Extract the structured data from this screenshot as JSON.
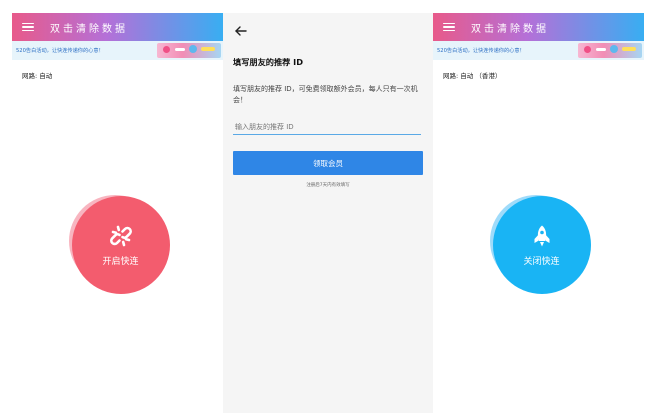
{
  "left": {
    "app_title": "双击清除数据",
    "banner_text": "520告白活动，让快连传递你的心意！",
    "mode_label": "网路: 自动",
    "button_label": "开启快连",
    "accent": "#f35c6e"
  },
  "middle": {
    "title": "填写朋友的推荐 ID",
    "description": "填写朋友的推荐 ID，可免费领取额外会员，每人只有一次机会！",
    "input_placeholder": "输入朋友的推荐 ID",
    "submit_label": "领取会员",
    "note": "注册后7天内有效填写",
    "accent": "#2f86e6"
  },
  "right": {
    "app_title": "双击清除数据",
    "banner_text": "520告白活动，让快连传递你的心意！",
    "mode_label": "网路: 自动 （香港）",
    "button_label": "关闭快连",
    "accent": "#19b4f4"
  },
  "icons": {
    "menu": "menu-icon",
    "back": "back-arrow-icon",
    "connect": "broken-link-icon",
    "disconnect": "rocket-icon"
  }
}
